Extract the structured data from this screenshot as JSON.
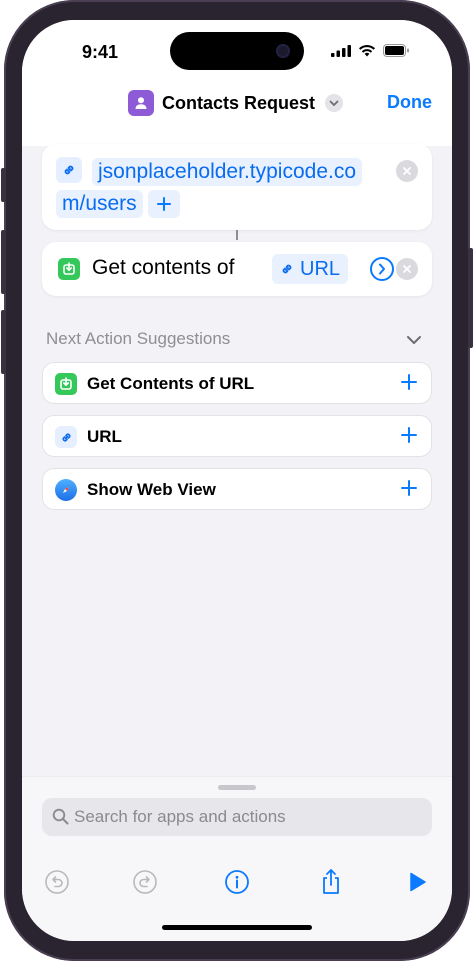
{
  "status_bar": {
    "time": "9:41"
  },
  "nav": {
    "title": "Contacts Request",
    "done_label": "Done"
  },
  "url_action": {
    "url_line1": "jsonplaceholder.typicode.co",
    "url_line2": "m/users"
  },
  "get_contents_action": {
    "label": "Get contents of",
    "variable_label": "URL"
  },
  "suggestions": {
    "header": "Next Action Suggestions",
    "items": [
      {
        "label": "Get Contents of URL",
        "icon": "download-icon"
      },
      {
        "label": "URL",
        "icon": "link-icon"
      },
      {
        "label": "Show Web View",
        "icon": "safari-compass-icon"
      }
    ]
  },
  "search": {
    "placeholder": "Search for apps and actions",
    "value": ""
  },
  "colors": {
    "accent": "#0a7aff",
    "app_icon": "#8e5bd6",
    "green": "#34c759"
  }
}
